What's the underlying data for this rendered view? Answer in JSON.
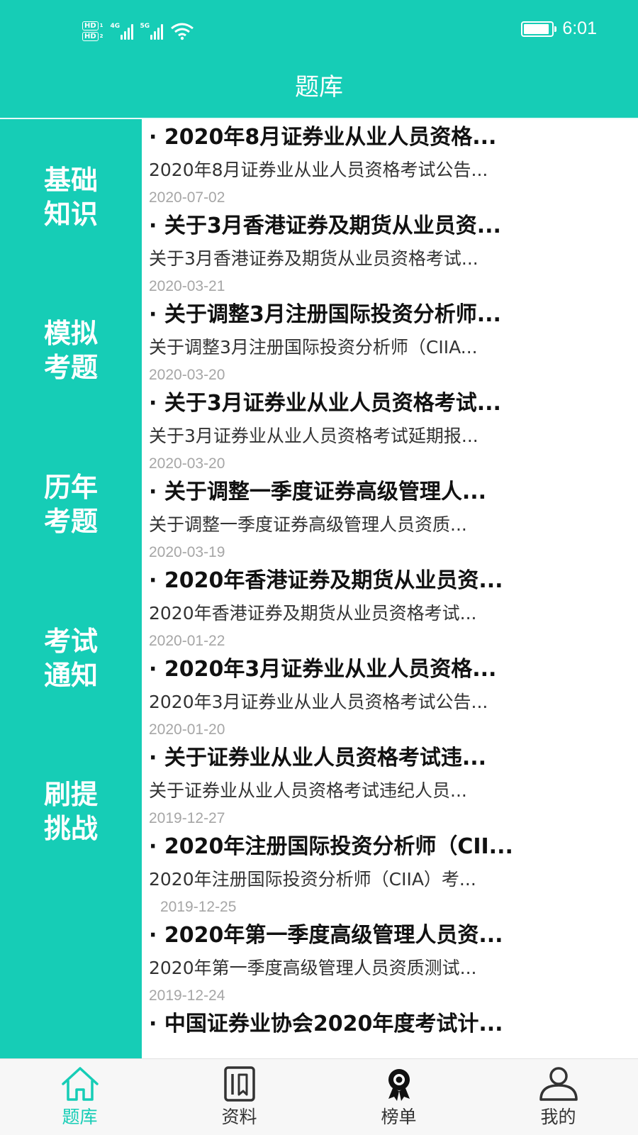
{
  "status_bar": {
    "hd1": "HD",
    "hd1_sub": "1",
    "hd2": "HD",
    "hd2_sub": "2",
    "net1": "4G",
    "net2": "5G",
    "time": "6:01",
    "battery_level": 0.9
  },
  "header": {
    "title": "题库"
  },
  "sidebar": {
    "items": [
      {
        "line1": "基础",
        "line2": "知识"
      },
      {
        "line1": "模拟",
        "line2": "考题"
      },
      {
        "line1": "历年",
        "line2": "考题"
      },
      {
        "line1": "考试",
        "line2": "通知"
      },
      {
        "line1": "刷提",
        "line2": "挑战"
      }
    ]
  },
  "news": [
    {
      "title": "· 2020年8月证券业从业人员资格...",
      "summary": "2020年8月证券业从业人员资格考试公告...",
      "date": "2020-07-02"
    },
    {
      "title": "· 关于3月香港证券及期货从业员资...",
      "summary": "关于3月香港证券及期货从业员资格考试...",
      "date": "2020-03-21"
    },
    {
      "title": "· 关于调整3月注册国际投资分析师...",
      "summary": "关于调整3月注册国际投资分析师（CIIA...",
      "date": "2020-03-20"
    },
    {
      "title": "· 关于3月证券业从业人员资格考试...",
      "summary": "关于3月证券业从业人员资格考试延期报...",
      "date": "2020-03-20"
    },
    {
      "title": "· 关于调整一季度证券高级管理人...",
      "summary": "关于调整一季度证券高级管理人员资质...",
      "date": "2020-03-19"
    },
    {
      "title": "· 2020年香港证券及期货从业员资...",
      "summary": "2020年香港证券及期货从业员资格考试...",
      "date": "2020-01-22"
    },
    {
      "title": "· 2020年3月证券业从业人员资格...",
      "summary": "2020年3月证券业从业人员资格考试公告...",
      "date": "2020-01-20"
    },
    {
      "title": "· 关于证券业从业人员资格考试违...",
      "summary": "关于证券业从业人员资格考试违纪人员...",
      "date": "2019-12-27"
    },
    {
      "title": "· 2020年注册国际投资分析师（CII...",
      "summary": "2020年注册国际投资分析师（CIIA）考...",
      "date": "2019-12-25"
    },
    {
      "title": "· 2020年第一季度高级管理人员资...",
      "summary": "2020年第一季度高级管理人员资质测试...",
      "date": "2019-12-24"
    },
    {
      "title": "· 中国证券业协会2020年度考试计...",
      "summary": "",
      "date": ""
    }
  ],
  "tabs": [
    {
      "label": "题库",
      "icon": "home-icon",
      "active": true
    },
    {
      "label": "资料",
      "icon": "document-icon",
      "active": false
    },
    {
      "label": "榜单",
      "icon": "award-icon",
      "active": false
    },
    {
      "label": "我的",
      "icon": "user-icon",
      "active": false
    }
  ],
  "colors": {
    "accent": "#16cdb6",
    "title_text": "#111111",
    "summary_text": "#333333",
    "date_text": "#a6a6a6"
  }
}
